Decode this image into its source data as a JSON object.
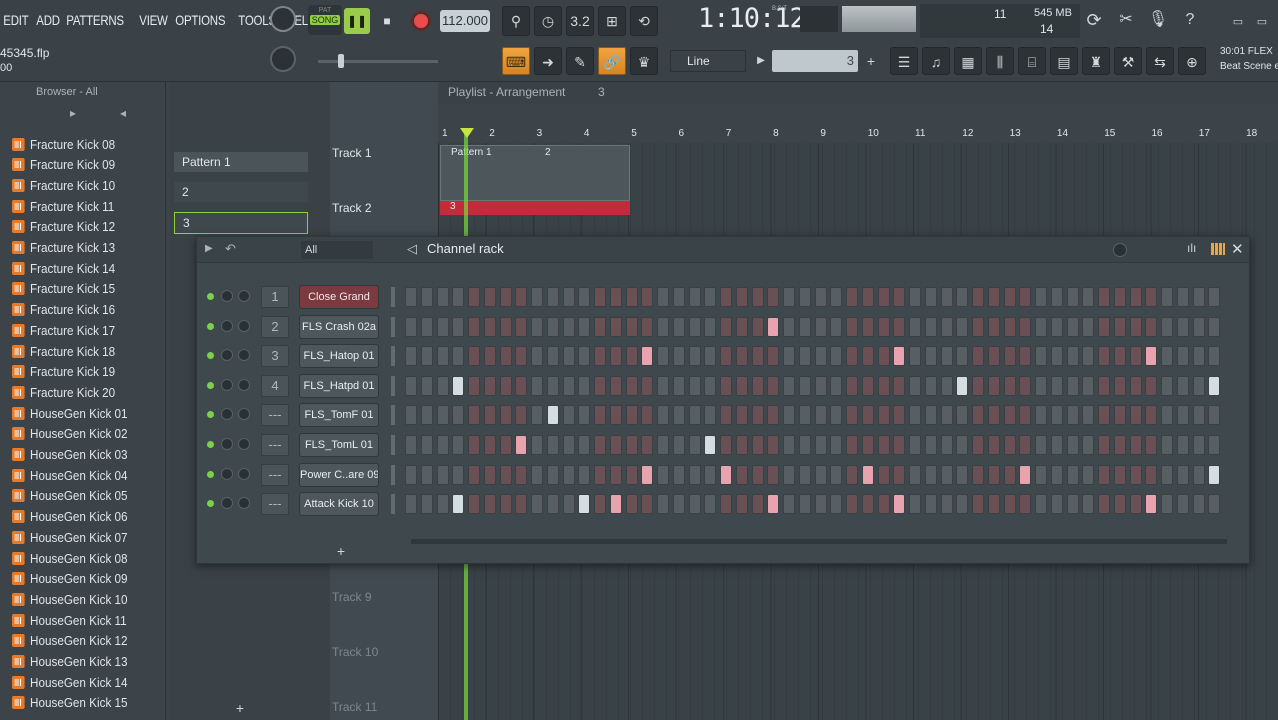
{
  "menu": [
    "EDIT",
    "ADD",
    "PATTERNS",
    "VIEW",
    "OPTIONS",
    "TOOLS",
    "HELP"
  ],
  "file": {
    "name": "45345.flp",
    "sub": "00"
  },
  "transport": {
    "mode_pat": "PAT",
    "mode_song": "SONG",
    "tempo": "112.000",
    "time": "1:10:12",
    "time_suffix": "B:S:T"
  },
  "cpu": {
    "voices": "11",
    "ram": "545 MB",
    "poly": "14"
  },
  "snap": {
    "label": "Line",
    "pattern_no": "3"
  },
  "news": {
    "line1": "30:01  FLEX",
    "line2": "Beat Scene e"
  },
  "browser": {
    "title": "Browser - All",
    "items": [
      "Fracture Kick 08",
      "Fracture Kick 09",
      "Fracture Kick 10",
      "Fracture Kick 11",
      "Fracture Kick 12",
      "Fracture Kick 13",
      "Fracture Kick 14",
      "Fracture Kick 15",
      "Fracture Kick 16",
      "Fracture Kick 17",
      "Fracture Kick 18",
      "Fracture Kick 19",
      "Fracture Kick 20",
      "HouseGen Kick 01",
      "HouseGen Kick 02",
      "HouseGen Kick 03",
      "HouseGen Kick 04",
      "HouseGen Kick 05",
      "HouseGen Kick 06",
      "HouseGen Kick 07",
      "HouseGen Kick 08",
      "HouseGen Kick 09",
      "HouseGen Kick 10",
      "HouseGen Kick 11",
      "HouseGen Kick 12",
      "HouseGen Kick 13",
      "HouseGen Kick 14",
      "HouseGen Kick 15"
    ]
  },
  "playlist": {
    "title": "Playlist - Arrangement",
    "pattern": "3",
    "patterns": [
      "Pattern 1",
      "2",
      "3"
    ],
    "ruler": [
      "1",
      "2",
      "3",
      "4",
      "5",
      "6",
      "7",
      "8",
      "9",
      "10",
      "11",
      "12",
      "13",
      "14",
      "15",
      "16",
      "17",
      "18"
    ],
    "tracks": [
      "Track 1",
      "Track 2",
      "Track 9",
      "Track 10",
      "Track 11"
    ],
    "clips": [
      "Pattern 1",
      "2",
      "3"
    ]
  },
  "rack": {
    "title": "Channel rack",
    "filter": "All",
    "channels": [
      {
        "num": "1",
        "name": "Close Grand",
        "selected": true,
        "on": []
      },
      {
        "num": "2",
        "name": "FLS Crash 02a",
        "on": [
          23
        ]
      },
      {
        "num": "3",
        "name": "FLS_Hatop 01",
        "on": [
          15,
          31,
          47
        ]
      },
      {
        "num": "4",
        "name": "FLS_Hatpd 01",
        "on": [
          3,
          35,
          51
        ]
      },
      {
        "num": "---",
        "name": "FLS_TomF 01",
        "on": [
          9
        ]
      },
      {
        "num": "---",
        "name": "FLS_TomL 01",
        "on": [
          7,
          19
        ]
      },
      {
        "num": "---",
        "name": "Power C..are 09",
        "on": [
          15,
          20,
          29,
          39,
          51
        ]
      },
      {
        "num": "---",
        "name": "Attack Kick 10",
        "on": [
          3,
          11,
          13,
          23,
          31,
          47
        ]
      }
    ]
  }
}
